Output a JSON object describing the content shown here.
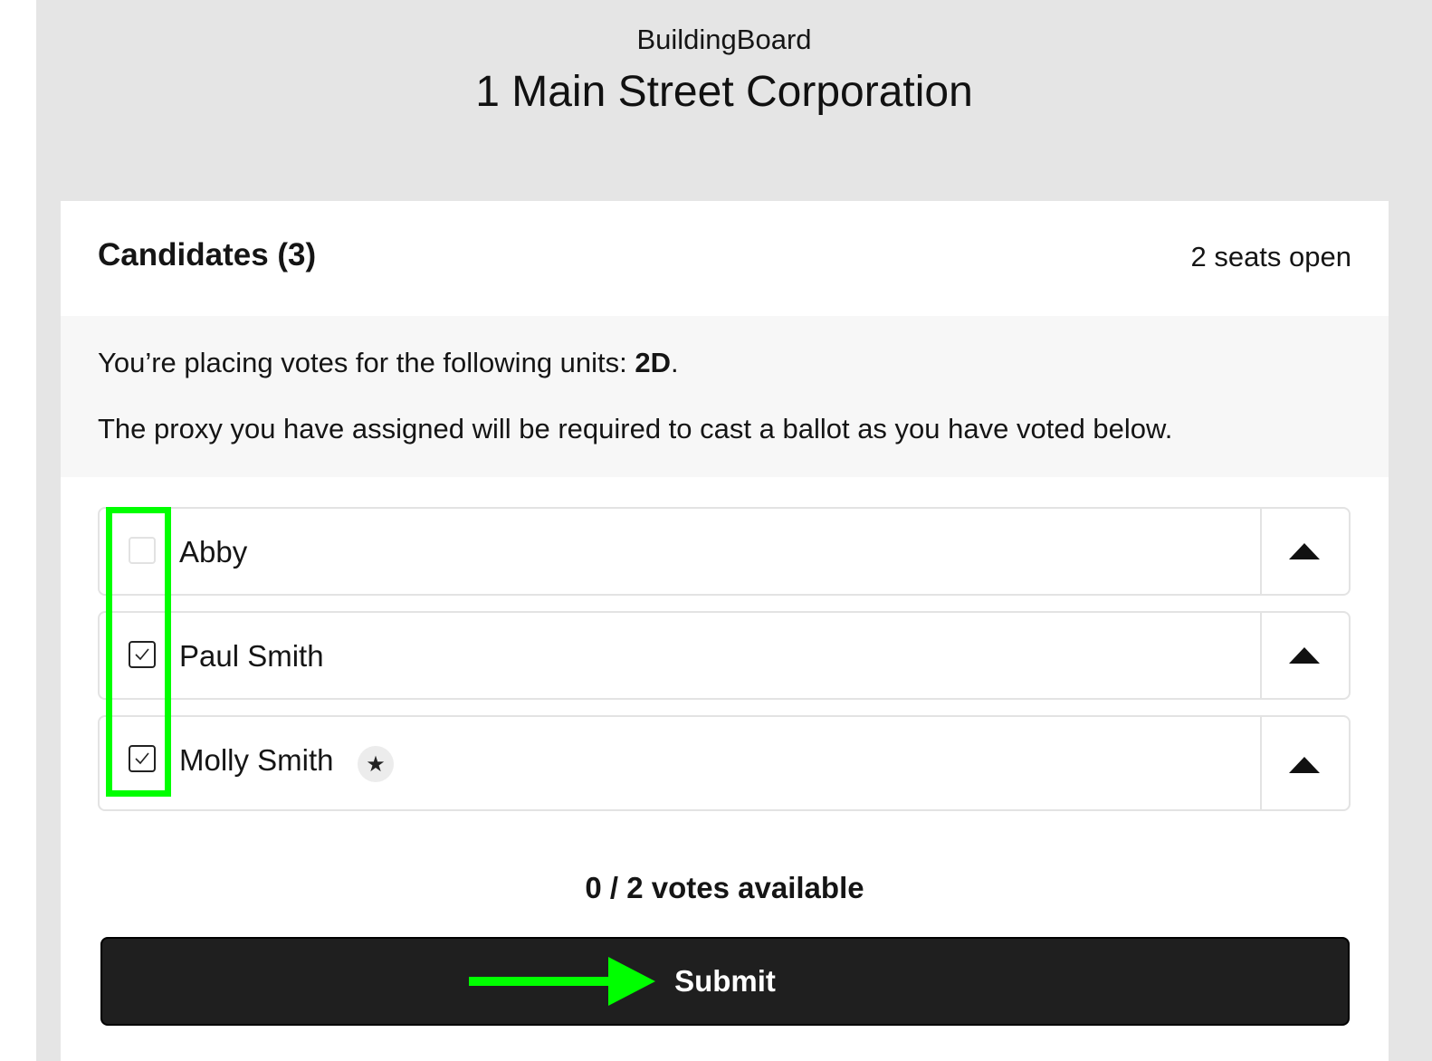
{
  "header": {
    "brand": "BuildingBoard",
    "title": "1 Main Street Corporation"
  },
  "candidates_panel": {
    "title": "Candidates (3)",
    "seats": "2 seats open",
    "notice": {
      "line1_prefix": "You’re placing votes for the following units: ",
      "unit": "2D",
      "line1_suffix": ".",
      "line2": "The proxy you have assigned will be required to cast a ballot as you have voted below."
    },
    "candidates": [
      {
        "name": "Abby",
        "checked": false,
        "starred": false
      },
      {
        "name": "Paul Smith",
        "checked": true,
        "starred": false
      },
      {
        "name": "Molly Smith",
        "checked": true,
        "starred": true,
        "star_glyph": "★"
      }
    ]
  },
  "footer": {
    "votes_available": "0 / 2 votes available",
    "submit_label": "Submit"
  },
  "annotation_colors": {
    "highlight": "#00ff00"
  },
  "icons": {
    "checkbox": "checkbox-icon",
    "check": "check-icon",
    "star": "star-icon",
    "collapse": "chevron-up-icon"
  }
}
